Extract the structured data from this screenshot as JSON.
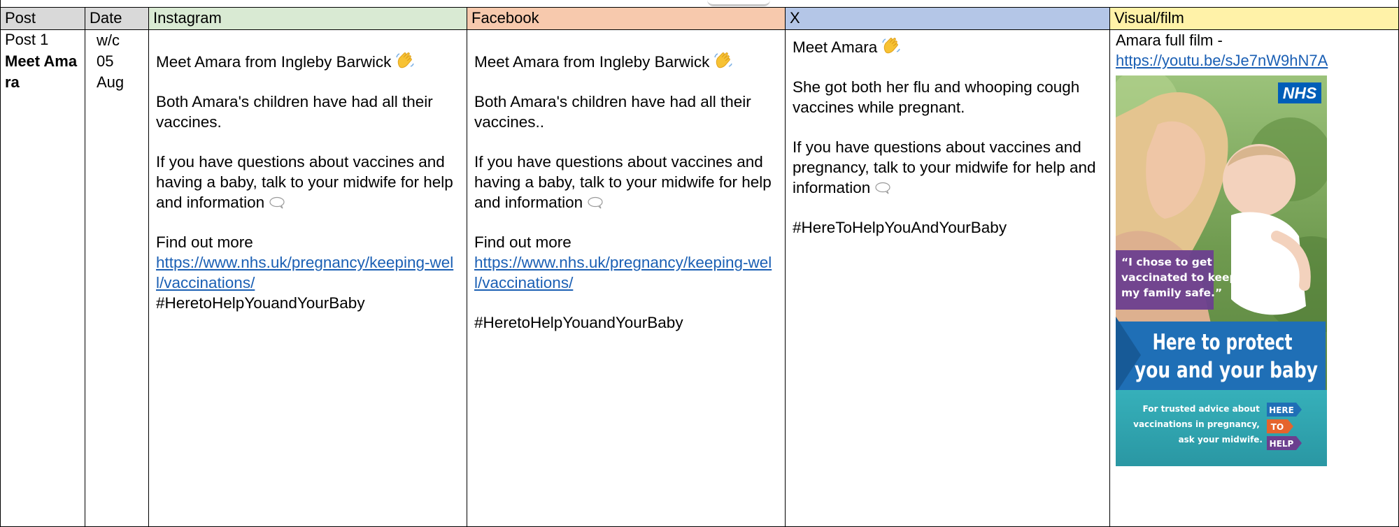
{
  "headers": {
    "post": "Post",
    "date": "Date",
    "instagram": "Instagram",
    "facebook": "Facebook",
    "x": "X",
    "visual": "Visual/film"
  },
  "row": {
    "post_num": "Post 1",
    "post_title": "Meet Amara",
    "date_line1": "w/c",
    "date_line2": "05",
    "date_line3": "Aug",
    "instagram": {
      "p1": "Meet Amara from Ingleby Barwick",
      "p2": "Both Amara's children have had all their vaccines.",
      "p3": "If you have questions about vaccines and having a baby, talk to your midwife for help and information",
      "p4": "Find out more",
      "link": "https://www.nhs.uk/pregnancy/keeping-well/vaccinations/",
      "hashtag": "#HeretoHelpYouandYourBaby"
    },
    "facebook": {
      "p1": "Meet Amara from Ingleby Barwick",
      "p2": "Both Amara's children have had all their vaccines..",
      "p3": "If you have questions about vaccines and having a baby, talk to your midwife for help and information",
      "p4": "Find out more",
      "link": "https://www.nhs.uk/pregnancy/keeping-well/vaccinations/",
      "hashtag": "#HeretoHelpYouandYourBaby"
    },
    "x": {
      "p1": "Meet Amara",
      "p2": "She got both her flu and whooping cough vaccines while pregnant.",
      "p3": "If you have questions about vaccines and pregnancy, talk to your midwife for help and information",
      "hashtag": "#HereToHelpYouAndYourBaby"
    },
    "visual": {
      "caption": "Amara full film -",
      "link": "https://youtu.be/sJe7nW9hN7A",
      "poster": {
        "logo": "NHS",
        "quote": "“I chose to get vaccinated to keep my family safe.”",
        "headline_1": "Here to protect",
        "headline_2": "you and your baby",
        "advice_1": "For trusted advice about",
        "advice_2": "vaccinations in pregnancy,",
        "advice_3": "ask your midwife.",
        "tag_1": "HERE",
        "tag_2": "TO",
        "tag_3": "HELP"
      }
    }
  },
  "icons": [
    "waving-hand-icon",
    "speech-bubble-icon"
  ],
  "colors": {
    "header_grey": "#d9d9d9",
    "header_instagram": "#d9ead3",
    "header_facebook": "#f7c9ad",
    "header_x": "#b4c6e7",
    "header_visual": "#fff2a8",
    "link": "#1a5fb4",
    "nhs_blue": "#005eb8",
    "poster_purple": "#6b3f8f",
    "poster_teal": "#2fa3b0"
  }
}
